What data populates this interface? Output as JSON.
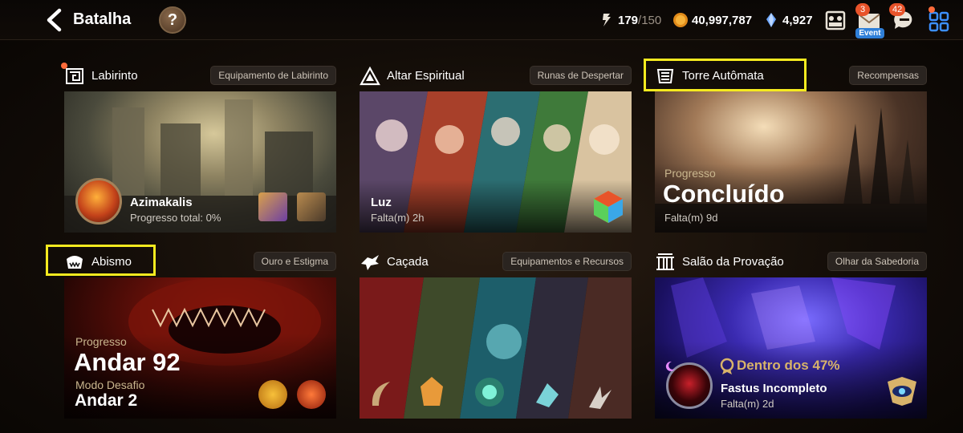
{
  "header": {
    "title": "Batalha",
    "help_symbol": "?",
    "stamina": "179",
    "stamina_max": "/150",
    "gold": "40,997,787",
    "skystone": "4,927",
    "mail_badge": "3",
    "event_label": "Event",
    "chat_badge": "42"
  },
  "cards": {
    "labirinto": {
      "name": "Labirinto",
      "tag": "Equipamento de Labirinto",
      "boss_name": "Azimakalis",
      "progress_text": "Progresso total: 0%"
    },
    "altar": {
      "name": "Altar Espiritual",
      "tag": "Runas de Despertar",
      "element": "Luz",
      "time_left": "Falta(m) 2h"
    },
    "torre": {
      "name": "Torre Autômata",
      "tag": "Recompensas",
      "progress_label": "Progresso",
      "status": "Concluído",
      "time_left": "Falta(m) 9d"
    },
    "abismo": {
      "name": "Abismo",
      "tag": "Ouro e Estigma",
      "progress_label": "Progresso",
      "floor": "Andar 92",
      "challenge_label": "Modo Desafio",
      "challenge_floor": "Andar 2"
    },
    "cacada": {
      "name": "Caçada",
      "tag": "Equipamentos e Recursos"
    },
    "salao": {
      "name": "Salão da Provação",
      "tag": "Olhar da Sabedoria",
      "rank": "Dentro dos 47%",
      "boss_name": "Fastus Incompleto",
      "time_left": "Falta(m) 2d"
    }
  },
  "colors": {
    "highlight": "#f5ea1f",
    "rank_gold": "#d8b36a",
    "notification": "#e8532a"
  },
  "icons": [
    "back-arrow-icon",
    "help-icon",
    "stamina-icon",
    "gold-coin-icon",
    "skystone-icon",
    "team-icon",
    "mail-icon",
    "chat-icon",
    "menu-grid-icon"
  ]
}
